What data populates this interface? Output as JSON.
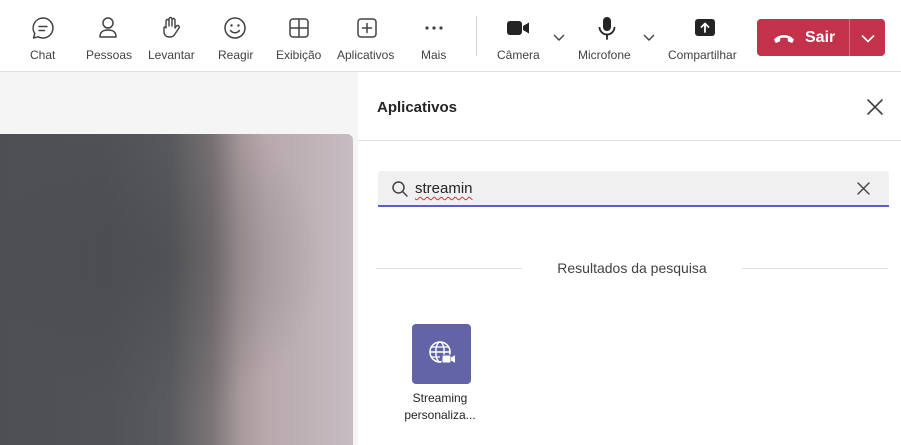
{
  "toolbar": {
    "items": [
      {
        "id": "chat",
        "label": "Chat",
        "icon": "chat-icon"
      },
      {
        "id": "people",
        "label": "Pessoas",
        "icon": "people-icon"
      },
      {
        "id": "raise",
        "label": "Levantar",
        "icon": "hand-icon"
      },
      {
        "id": "react",
        "label": "Reagir",
        "icon": "smile-icon"
      },
      {
        "id": "view",
        "label": "Exibição",
        "icon": "grid-icon"
      },
      {
        "id": "apps",
        "label": "Aplicativos",
        "icon": "plus-square-icon"
      },
      {
        "id": "more",
        "label": "Mais",
        "icon": "more-icon"
      },
      {
        "id": "camera",
        "label": "Câmera",
        "icon": "camera-icon"
      },
      {
        "id": "mic",
        "label": "Microfone",
        "icon": "microphone-icon"
      },
      {
        "id": "share",
        "label": "Compartilhar",
        "icon": "share-tray-icon"
      }
    ],
    "leave_label": "Sair",
    "leave_color": "#c4314b"
  },
  "panel": {
    "title": "Aplicativos",
    "search_value": "streamin",
    "results_label": "Resultados da pesquisa",
    "apps": [
      {
        "name_line1": "Streaming",
        "name_line2": "personaliza...",
        "icon": "globe-video-icon",
        "color": "#6264a7"
      }
    ]
  },
  "accent": "#5b5fc7"
}
